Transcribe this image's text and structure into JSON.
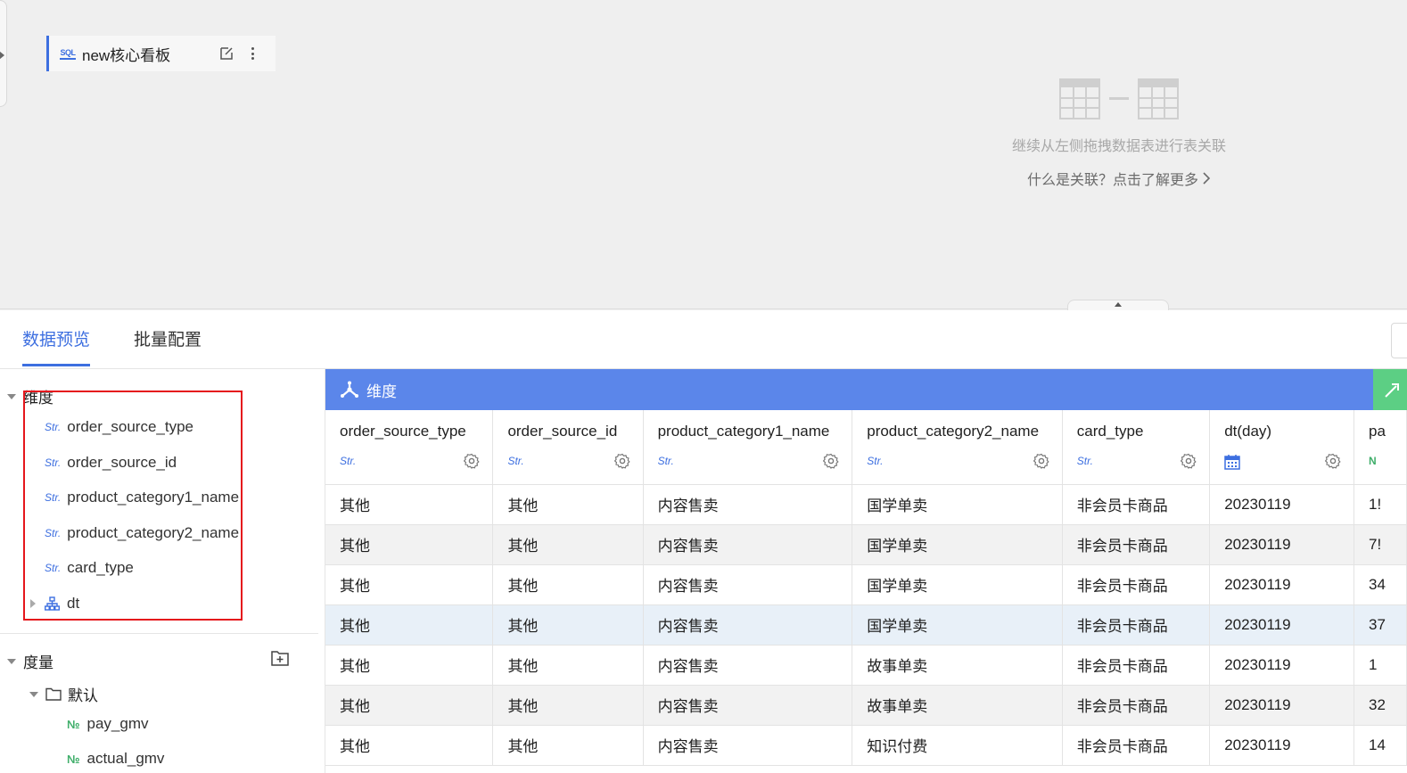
{
  "canvas": {
    "table_card": {
      "name": "new核心看板",
      "type_icon": "sql-icon"
    },
    "join_hint": {
      "text": "继续从左侧拖拽数据表进行表关联",
      "link": "什么是关联？点击了解更多"
    }
  },
  "tabs": [
    {
      "label": "数据预览",
      "active": true
    },
    {
      "label": "批量配置",
      "active": false
    }
  ],
  "fields": {
    "dimension_group": "维度",
    "dimensions": [
      {
        "type": "Str.",
        "name": "order_source_type"
      },
      {
        "type": "Str.",
        "name": "order_source_id"
      },
      {
        "type": "Str.",
        "name": "product_category1_name"
      },
      {
        "type": "Str.",
        "name": "product_category2_name"
      },
      {
        "type": "Str.",
        "name": "card_type"
      },
      {
        "type": "hierarchy",
        "name": "dt"
      }
    ],
    "measure_group": "度量",
    "measure_folder": "默认",
    "measures": [
      {
        "type": "№",
        "name": "pay_gmv"
      },
      {
        "type": "№",
        "name": "actual_gmv"
      }
    ]
  },
  "table": {
    "dimension_bar_label": "维度",
    "columns": [
      {
        "name": "order_source_type",
        "type": "Str."
      },
      {
        "name": "order_source_id",
        "type": "Str."
      },
      {
        "name": "product_category1_name",
        "type": "Str."
      },
      {
        "name": "product_category2_name",
        "type": "Str."
      },
      {
        "name": "card_type",
        "type": "Str."
      },
      {
        "name": "dt(day)",
        "type": "date"
      },
      {
        "name": "pa",
        "type": "N"
      }
    ],
    "rows": [
      [
        "其他",
        "其他",
        "内容售卖",
        "国学单卖",
        "非会员卡商品",
        "20230119",
        "1!"
      ],
      [
        "其他",
        "其他",
        "内容售卖",
        "国学单卖",
        "非会员卡商品",
        "20230119",
        "7!"
      ],
      [
        "其他",
        "其他",
        "内容售卖",
        "国学单卖",
        "非会员卡商品",
        "20230119",
        "34"
      ],
      [
        "其他",
        "其他",
        "内容售卖",
        "国学单卖",
        "非会员卡商品",
        "20230119",
        "37"
      ],
      [
        "其他",
        "其他",
        "内容售卖",
        "故事单卖",
        "非会员卡商品",
        "20230119",
        "1"
      ],
      [
        "其他",
        "其他",
        "内容售卖",
        "故事单卖",
        "非会员卡商品",
        "20230119",
        "32"
      ],
      [
        "其他",
        "其他",
        "内容售卖",
        "知识付费",
        "非会员卡商品",
        "20230119",
        "14"
      ]
    ]
  },
  "colors": {
    "accent": "#3d6fe0",
    "dimension_bar": "#5b86ea",
    "measure_bar": "#5ccf84",
    "highlight": "#e5161c",
    "number_tag": "#3fae6a"
  }
}
